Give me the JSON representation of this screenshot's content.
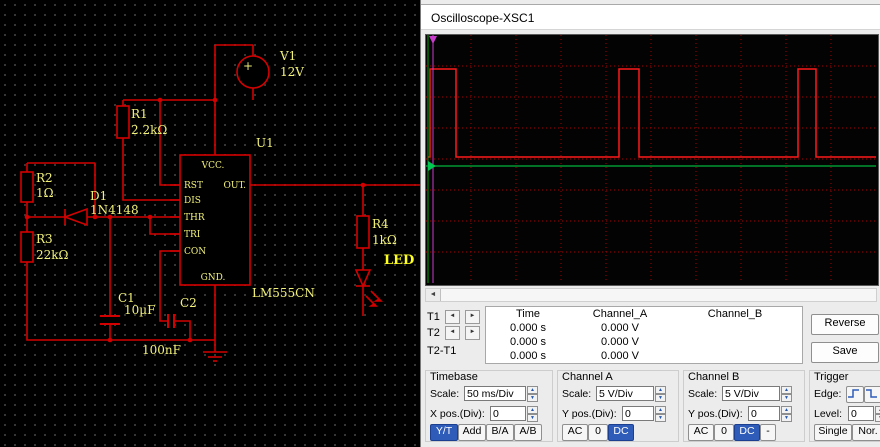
{
  "circuit": {
    "labels": {
      "v1_ref": "V1",
      "v1_val": "12V",
      "plus": "+",
      "r1_ref": "R1",
      "r1_val": "2.2kΩ",
      "r2_ref": "R2",
      "r2_val": "1Ω",
      "r3_ref": "R3",
      "r3_val": "22kΩ",
      "r4_ref": "R4",
      "r4_val": "1kΩ",
      "d1_ref": "D1",
      "d1_val": "1N4148",
      "u1_ref": "U1",
      "u1_val": "LM555CN",
      "c1_ref": "C1",
      "c1_val": "10µF",
      "c2_ref": "C2",
      "c2_val": "100nF",
      "led_ref": "LED"
    },
    "pins": {
      "vcc": "VCC.",
      "rst": "RST",
      "dis": "DIS",
      "thr": "THR",
      "tri": "TRI",
      "con": "CON",
      "gnd": "GND.",
      "out": "OUT."
    }
  },
  "oscilloscope": {
    "title": "Oscilloscope-XSC1",
    "scroll_left": "◄",
    "measure": {
      "col_time": "Time",
      "col_cha": "Channel_A",
      "col_chb": "Channel_B",
      "arrow_left": "◄",
      "arrow_right": "►",
      "rows": [
        {
          "label": "T1",
          "time": "0.000 s",
          "cha": "0.000 V",
          "chb": ""
        },
        {
          "label": "T2",
          "time": "0.000 s",
          "cha": "0.000 V",
          "chb": ""
        },
        {
          "label": "T2-T1",
          "time": "0.000 s",
          "cha": "0.000 V",
          "chb": ""
        }
      ],
      "reverse_btn": "Reverse",
      "save_btn": "Save"
    },
    "timebase": {
      "title": "Timebase",
      "scale_label": "Scale:",
      "scale_value": "50 ms/Div",
      "pos_label": "X pos.(Div):",
      "pos_value": "0",
      "btn_yt": "Y/T",
      "btn_add": "Add",
      "btn_ba": "B/A",
      "btn_ab": "A/B"
    },
    "channel_a": {
      "title": "Channel A",
      "scale_label": "Scale:",
      "scale_value": "5 V/Div",
      "pos_label": "Y pos.(Div):",
      "pos_value": "0",
      "btn_ac": "AC",
      "btn_0": "0",
      "btn_dc": "DC"
    },
    "channel_b": {
      "title": "Channel B",
      "scale_label": "Scale:",
      "scale_value": "5 V/Div",
      "pos_label": "Y pos.(Div):",
      "pos_value": "0",
      "btn_ac": "AC",
      "btn_0": "0",
      "btn_dc": "DC",
      "btn_minus": "-"
    },
    "trigger": {
      "title": "Trigger",
      "edge_label": "Edge:",
      "level_label": "Level:",
      "level_value": "0",
      "btn_single": "Single",
      "btn_nor": "Nor."
    },
    "colors": {
      "trace": "#ff1a1a",
      "grid": "#bb0000",
      "chb_line": "#00b43c"
    }
  }
}
